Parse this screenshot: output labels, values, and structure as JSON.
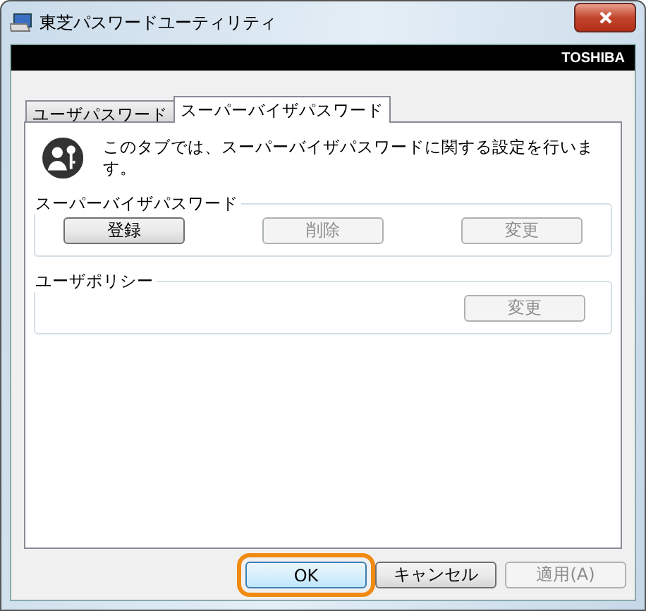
{
  "window": {
    "title": "東芝パスワードユーティリティ"
  },
  "banner": {
    "brand": "TOSHIBA"
  },
  "tabs": [
    {
      "label": "ユーザパスワード",
      "selected": false
    },
    {
      "label": "スーパーバイザパスワード",
      "selected": true
    }
  ],
  "description": "このタブでは、スーパーバイザパスワードに関する設定を行います。",
  "groups": [
    {
      "title": "スーパーバイザパスワード",
      "buttons": [
        {
          "label": "登録",
          "disabled": false
        },
        {
          "label": "削除",
          "disabled": true
        },
        {
          "label": "変更",
          "disabled": true
        }
      ]
    },
    {
      "title": "ユーザポリシー",
      "buttons": [
        {
          "label": "変更",
          "disabled": true
        }
      ]
    }
  ],
  "footer_buttons": [
    {
      "label": "OK",
      "disabled": false,
      "highlighted": true
    },
    {
      "label": "キャンセル",
      "disabled": false,
      "highlighted": false
    },
    {
      "label": "適用(A)",
      "disabled": true,
      "highlighted": false
    }
  ]
}
